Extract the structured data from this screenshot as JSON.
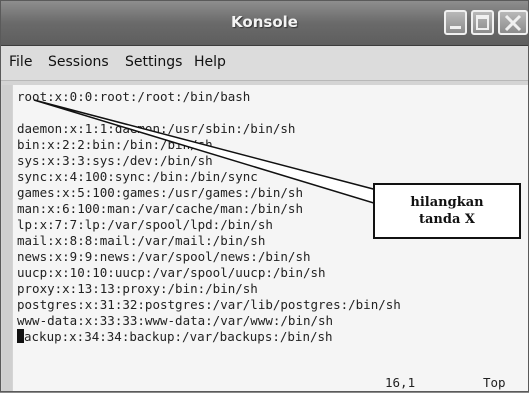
{
  "window": {
    "title": "Konsole",
    "buttons": [
      "minimize",
      "maximize",
      "close"
    ]
  },
  "menu": {
    "items": [
      "File",
      "Sessions",
      "Settings",
      "Help"
    ]
  },
  "terminal": {
    "lines": [
      "root:x:0:0:root:/root:/bin/bash",
      "",
      "daemon:x:1:1:daemon:/usr/sbin:/bin/sh",
      "bin:x:2:2:bin:/bin:/bin/sh",
      "sys:x:3:3:sys:/dev:/bin/sh",
      "sync:x:4:100:sync:/bin:/bin/sync",
      "games:x:5:100:games:/usr/games:/bin/sh",
      "man:x:6:100:man:/var/cache/man:/bin/sh",
      "lp:x:7:7:lp:/var/spool/lpd:/bin/sh",
      "mail:x:8:8:mail:/var/mail:/bin/sh",
      "news:x:9:9:news:/var/spool/news:/bin/sh",
      "uucp:x:10:10:uucp:/var/spool/uucp:/bin/sh",
      "proxy:x:13:13:proxy:/bin:/bin/sh",
      "postgres:x:31:32:postgres:/var/lib/postgres:/bin/sh",
      "www-data:x:33:33:www-data:/var/www:/bin/sh",
      "backup:x:34:34:backup:/var/backups:/bin/sh"
    ],
    "last_line_rest": "ackup:x:34:34:backup:/var/backups:/bin/sh",
    "status_position": "16,1",
    "status_scroll": "Top"
  },
  "annotation": {
    "line1": "hilangkan",
    "line2": "tanda X"
  },
  "colors": {
    "titlebar": "#6a6a6a",
    "terminal_bg": "#f5f5f5",
    "text": "#222222"
  }
}
